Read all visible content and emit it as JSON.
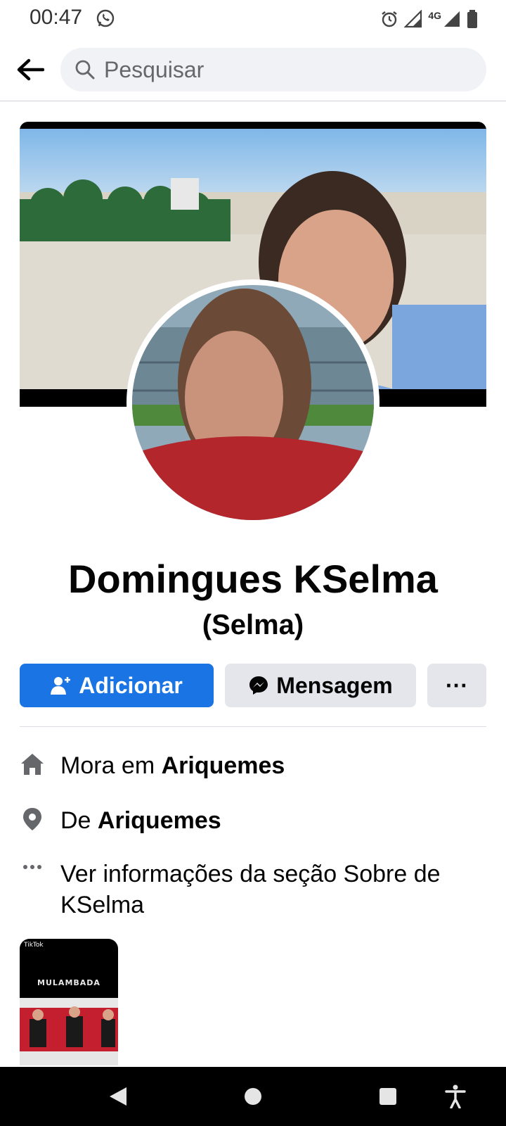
{
  "status_bar": {
    "time": "00:47",
    "network": "4G",
    "icons": [
      "whatsapp-icon",
      "alarm-icon",
      "signal-icon",
      "battery-icon"
    ]
  },
  "header": {
    "search_placeholder": "Pesquisar"
  },
  "profile": {
    "name": "Domingues KSelma",
    "alt_name": "(Selma)"
  },
  "actions": {
    "add_label": "Adicionar",
    "message_label": "Mensagem",
    "more_label": "···"
  },
  "intro": {
    "lives_prefix": "Mora em ",
    "lives_place": "Ariquemes",
    "from_prefix": "De ",
    "from_place": "Ariquemes",
    "about_text": "Ver informações da seção Sobre de KSelma"
  },
  "thumbnail": {
    "tiktok_label": "TikTok",
    "title": "MULAMBADA"
  },
  "colors": {
    "accent": "#1b74e4",
    "button_gray": "#e4e6eb",
    "search_bg": "#f0f2f5"
  }
}
